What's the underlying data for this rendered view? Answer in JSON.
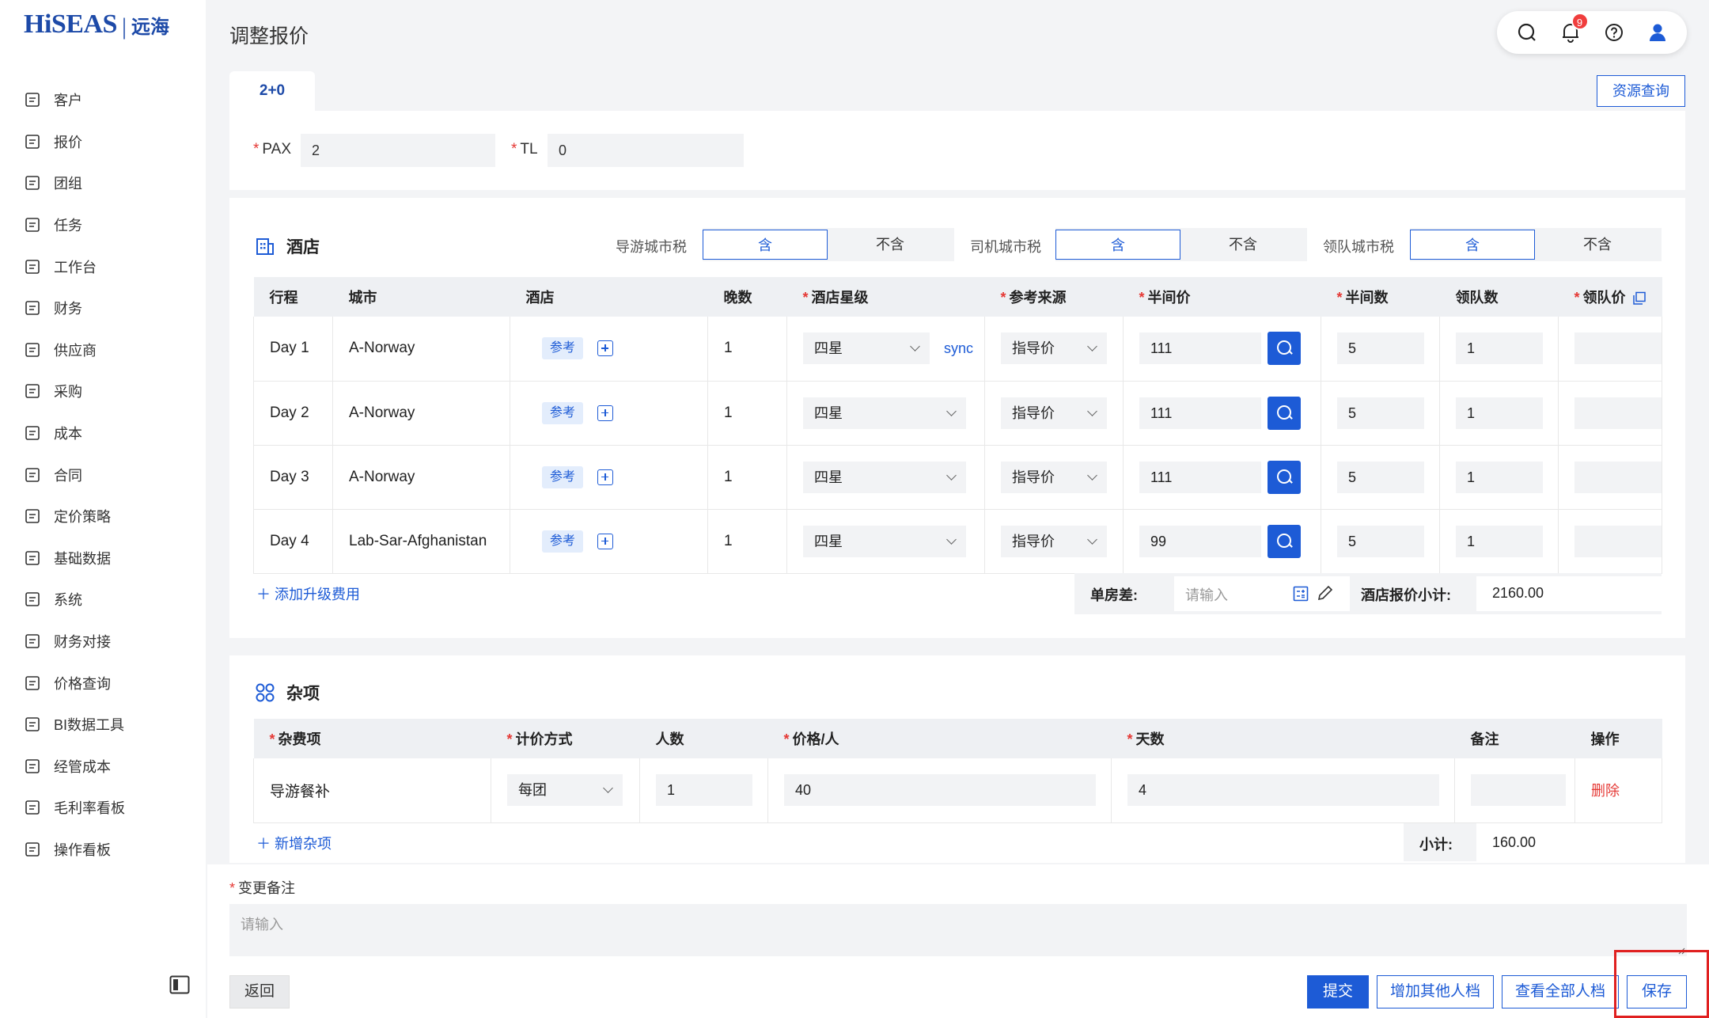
{
  "brand": {
    "name_en": "HiSEAS",
    "sep": "|",
    "name_cn": "远海"
  },
  "sidebar": {
    "items": [
      {
        "label": "客户",
        "icon": "customer-icon"
      },
      {
        "label": "报价",
        "icon": "quote-icon"
      },
      {
        "label": "团组",
        "icon": "group-icon"
      },
      {
        "label": "任务",
        "icon": "task-icon"
      },
      {
        "label": "工作台",
        "icon": "workbench-icon"
      },
      {
        "label": "财务",
        "icon": "finance-icon"
      },
      {
        "label": "供应商",
        "icon": "supplier-icon"
      },
      {
        "label": "采购",
        "icon": "purchase-icon"
      },
      {
        "label": "成本",
        "icon": "cost-icon"
      },
      {
        "label": "合同",
        "icon": "contract-icon"
      },
      {
        "label": "定价策略",
        "icon": "pricing-strategy-icon"
      },
      {
        "label": "基础数据",
        "icon": "base-data-icon"
      },
      {
        "label": "系统",
        "icon": "system-icon"
      },
      {
        "label": "财务对接",
        "icon": "finance-integration-icon"
      },
      {
        "label": "价格查询",
        "icon": "price-query-icon"
      },
      {
        "label": "BI数据工具",
        "icon": "bi-tool-icon"
      },
      {
        "label": "经管成本",
        "icon": "management-cost-icon"
      },
      {
        "label": "毛利率看板",
        "icon": "gross-margin-board-icon"
      },
      {
        "label": "操作看板",
        "icon": "operation-board-icon"
      }
    ]
  },
  "header": {
    "title": "调整报价",
    "notification_count": "9"
  },
  "tab": {
    "label": "2+0"
  },
  "resource_button": "资源查询",
  "pax": {
    "label": "PAX",
    "value": "2"
  },
  "tl": {
    "label": "TL",
    "value": "0"
  },
  "hotel": {
    "title": "酒店",
    "taxes": [
      {
        "label": "导游城市税",
        "include": "含",
        "exclude": "不含",
        "selected": "含"
      },
      {
        "label": "司机城市税",
        "include": "含",
        "exclude": "不含",
        "selected": "含"
      },
      {
        "label": "领队城市税",
        "include": "含",
        "exclude": "不含",
        "selected": "含"
      }
    ],
    "columns": [
      "行程",
      "城市",
      "酒店",
      "晚数",
      "酒店星级",
      "参考来源",
      "半间价",
      "半间数",
      "领队数",
      "领队价"
    ],
    "ref_tag": "参考",
    "sync_label": "sync",
    "rows": [
      {
        "day": "Day 1",
        "city": "A-Norway",
        "nights": "1",
        "star": "四星",
        "source": "指导价",
        "half_price": "111",
        "half_count": "5",
        "leader_count": "1",
        "leader_price": ""
      },
      {
        "day": "Day 2",
        "city": "A-Norway",
        "nights": "1",
        "star": "四星",
        "source": "指导价",
        "half_price": "111",
        "half_count": "5",
        "leader_count": "1",
        "leader_price": ""
      },
      {
        "day": "Day 3",
        "city": "A-Norway",
        "nights": "1",
        "star": "四星",
        "source": "指导价",
        "half_price": "111",
        "half_count": "5",
        "leader_count": "1",
        "leader_price": ""
      },
      {
        "day": "Day 4",
        "city": "Lab-Sar-Afghanistan",
        "nights": "1",
        "star": "四星",
        "source": "指导价",
        "half_price": "99",
        "half_count": "5",
        "leader_count": "1",
        "leader_price": ""
      }
    ],
    "add_upgrade": "添加升级费用",
    "single_diff_label": "单房差:",
    "single_diff_placeholder": "请输入",
    "subtotal_label": "酒店报价小计:",
    "subtotal_value": "2160.00"
  },
  "misc": {
    "title": "杂项",
    "columns": [
      "杂费项",
      "计价方式",
      "人数",
      "价格/人",
      "天数",
      "备注",
      "操作"
    ],
    "rows": [
      {
        "item": "导游餐补",
        "method": "每团",
        "people": "1",
        "price": "40",
        "days": "4",
        "note": "",
        "action": "删除"
      }
    ],
    "add_label": "新增杂项",
    "subtotal_label": "小计:",
    "subtotal_value": "160.00"
  },
  "change_note": {
    "label": "变更备注",
    "placeholder": "请输入"
  },
  "footer": {
    "back": "返回",
    "submit": "提交",
    "add_archive": "增加其他人档",
    "view_all": "查看全部人档",
    "save": "保存"
  },
  "colors": {
    "primary": "#1d5bd6",
    "danger": "#e53935",
    "highlight": "#e02020"
  }
}
